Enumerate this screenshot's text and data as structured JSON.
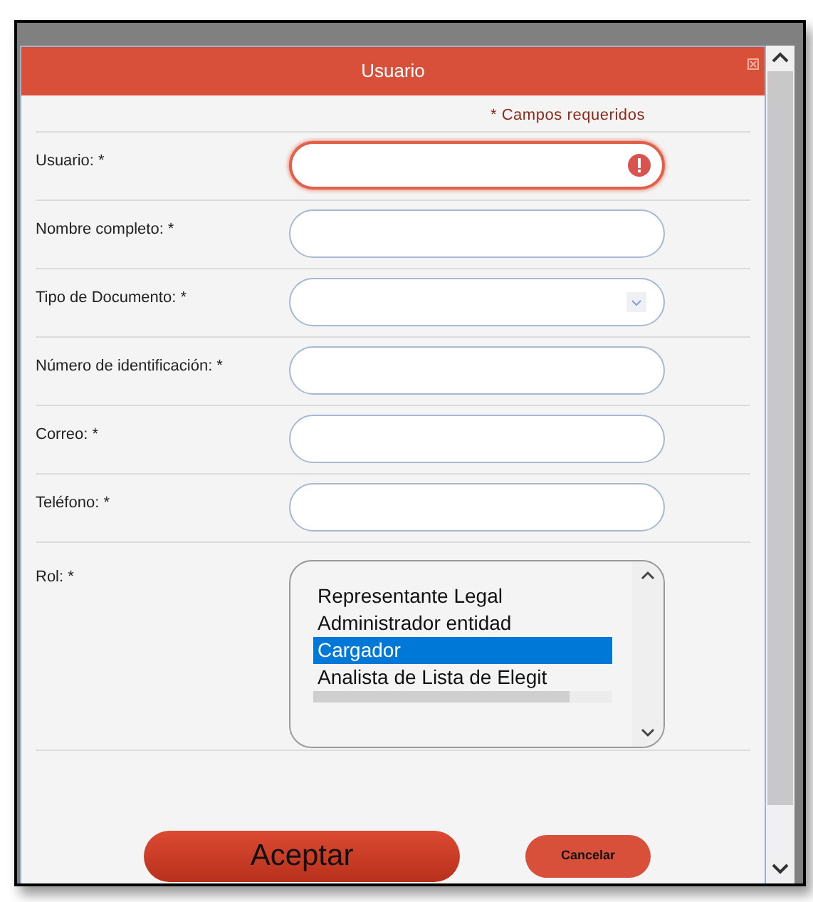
{
  "dialog": {
    "title": "Usuario",
    "required_note": "* Campos requeridos"
  },
  "fields": [
    {
      "label": "Usuario: *",
      "kind": "text",
      "error": true
    },
    {
      "label": "Nombre completo: *",
      "kind": "text",
      "error": false
    },
    {
      "label": "Tipo de Documento: *",
      "kind": "select",
      "error": false
    },
    {
      "label": "Número de identificación: *",
      "kind": "text",
      "error": false
    },
    {
      "label": "Correo: *",
      "kind": "text",
      "error": false
    },
    {
      "label": "Teléfono: *",
      "kind": "text",
      "error": false
    }
  ],
  "role": {
    "label": "Rol: *",
    "options": [
      {
        "text": "Representante Legal",
        "selected": false
      },
      {
        "text": "Administrador entidad",
        "selected": false
      },
      {
        "text": "Cargador",
        "selected": true
      },
      {
        "text": "Analista de Lista de Elegit",
        "selected": false
      }
    ]
  },
  "buttons": [
    {
      "label": "Aceptar",
      "kind": "primary"
    },
    {
      "label": "Cancelar",
      "kind": "secondary"
    }
  ]
}
